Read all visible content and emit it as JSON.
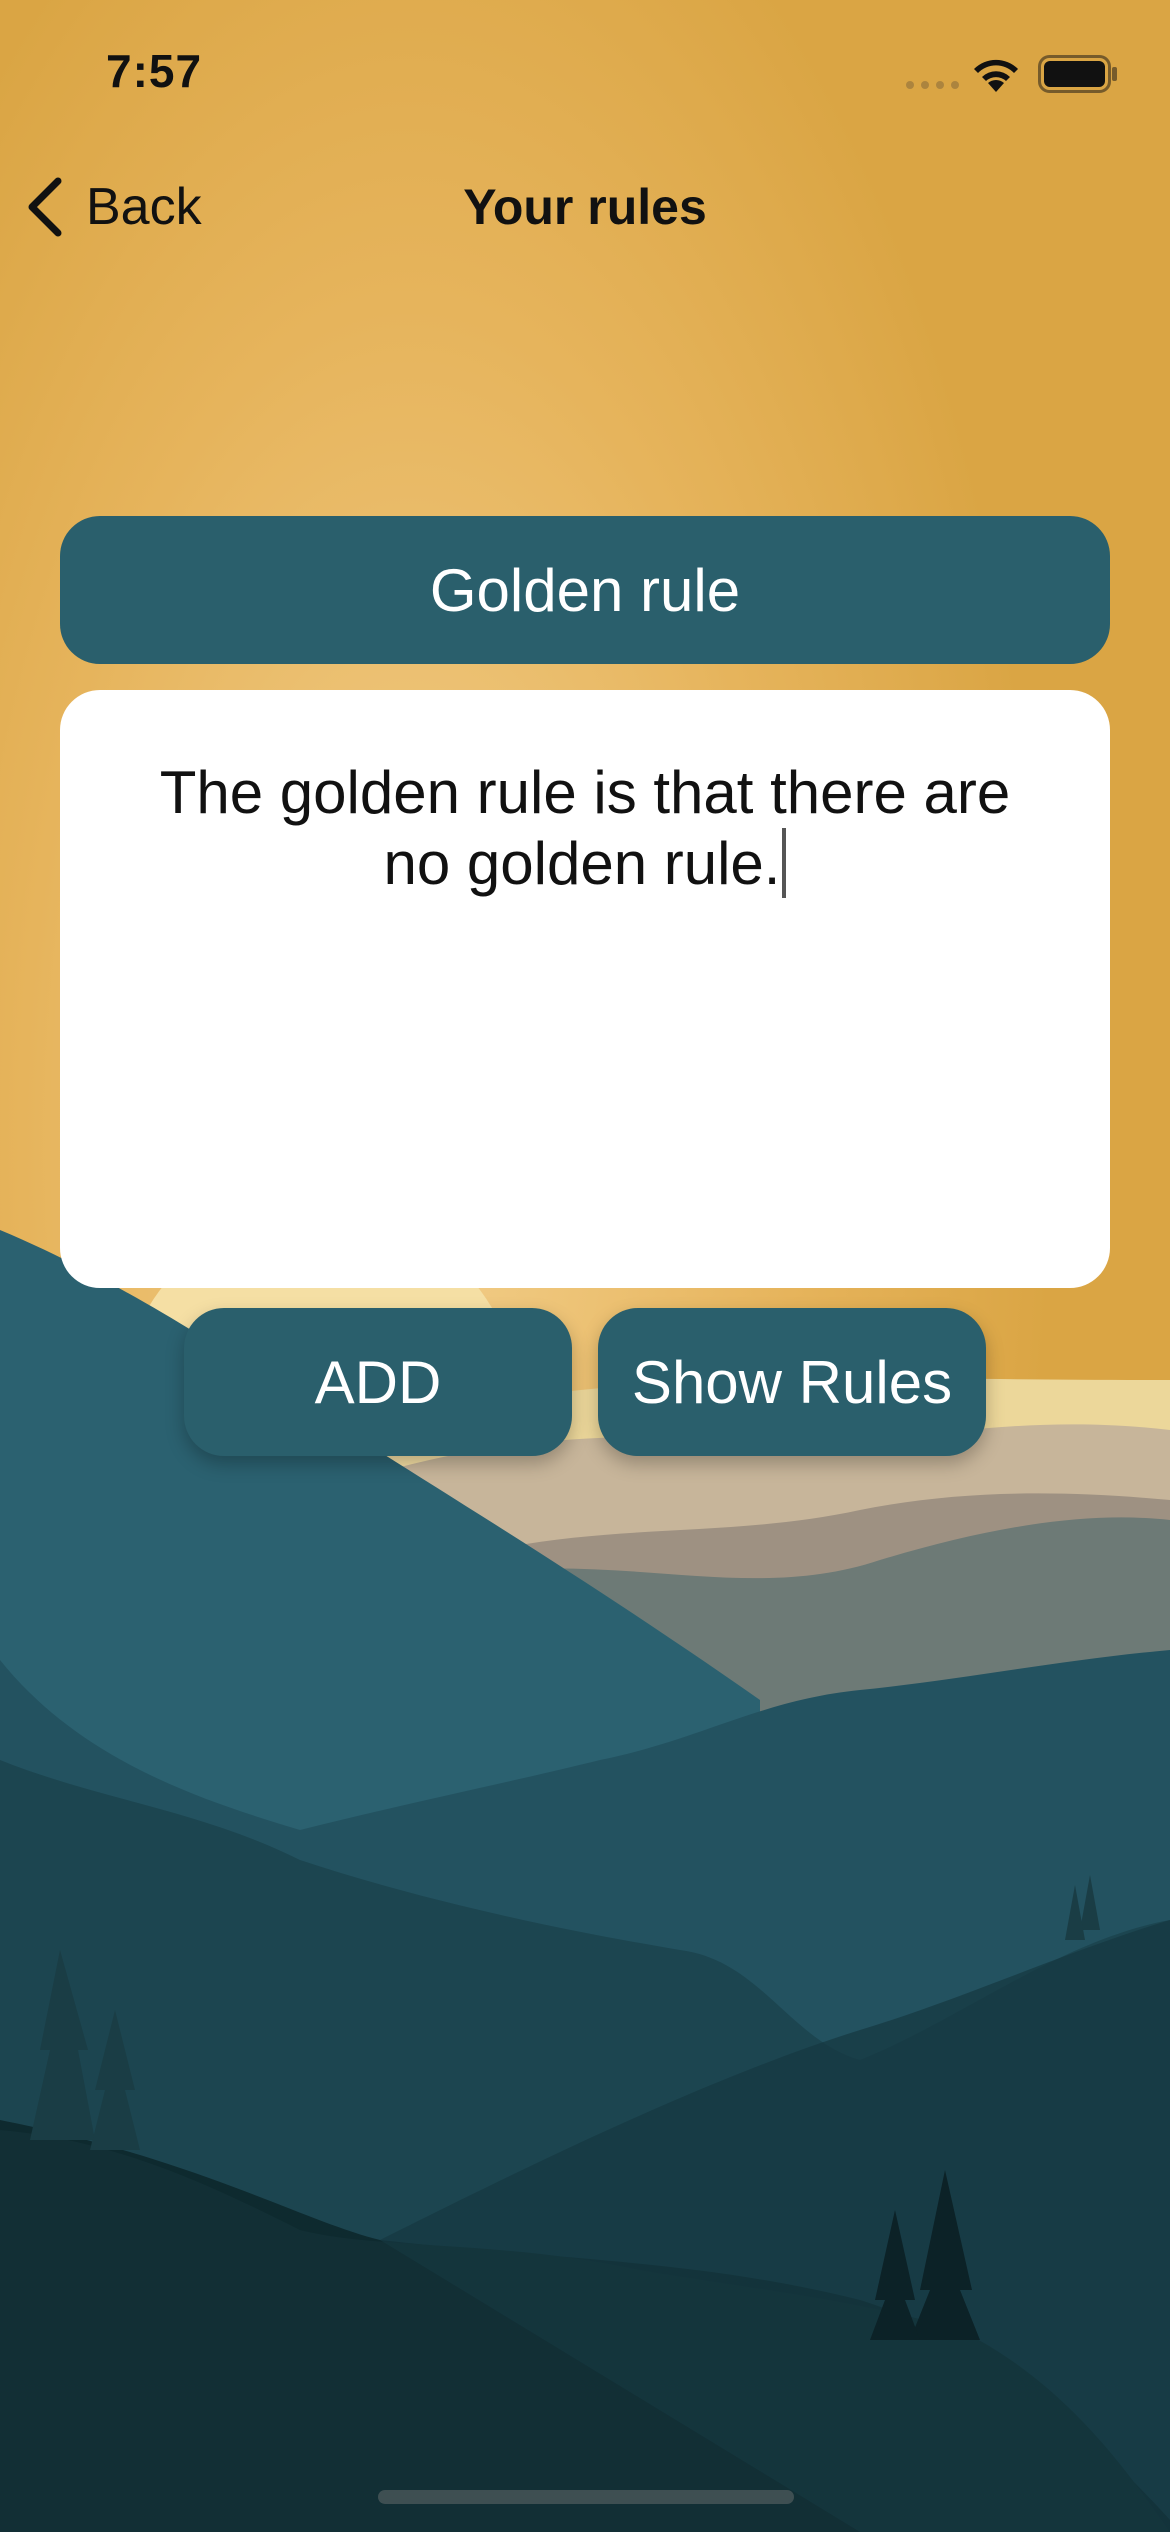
{
  "status_bar": {
    "time": "7:57"
  },
  "nav": {
    "back_label": "Back",
    "title": "Your rules"
  },
  "rule": {
    "title": "Golden rule",
    "body": "The golden rule is  that there are no golden rule."
  },
  "actions": {
    "add_label": "ADD",
    "show_label": "Show Rules"
  },
  "colors": {
    "sky": "#daa544",
    "accent": "#2a5f6c",
    "card": "#ffffff"
  }
}
